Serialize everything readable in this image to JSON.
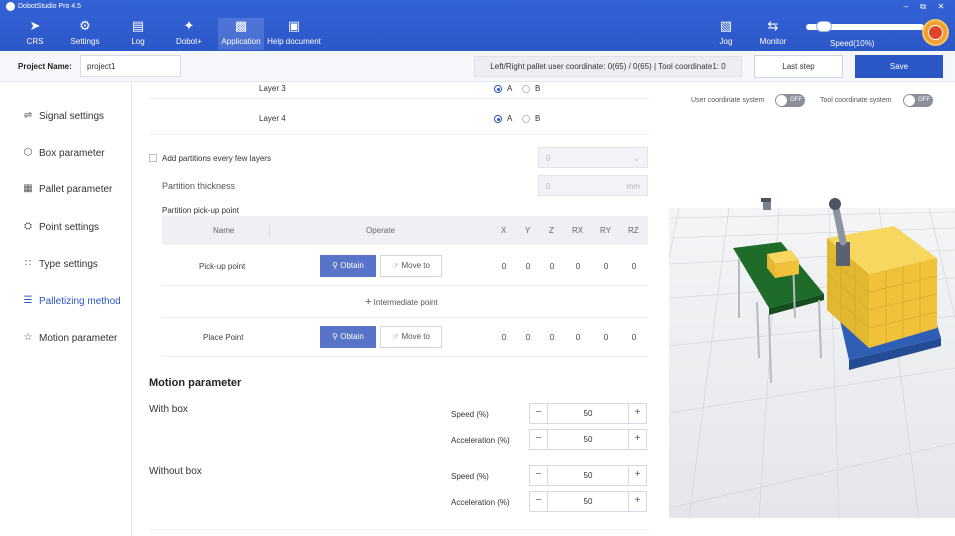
{
  "app": {
    "title": "DobotStudio Pro 4.5"
  },
  "nav": [
    {
      "label": "CRS",
      "icon": "crs-icon"
    },
    {
      "label": "Settings",
      "icon": "gear-icon"
    },
    {
      "label": "Log",
      "icon": "log-icon"
    },
    {
      "label": "Dobot+",
      "icon": "puzzle-icon"
    },
    {
      "label": "Application",
      "icon": "application-icon"
    },
    {
      "label": "Help document",
      "icon": "help-document-icon"
    }
  ],
  "right_nav": {
    "jog": "Jog",
    "monitor": "Monitor",
    "speed": "Speed(10%)",
    "speed_value": 10
  },
  "project": {
    "label": "Project Name:",
    "name": "project1",
    "coord_info": "Left/Right pallet user coordinate: 0(65) / 0(65) | Tool coordinate1: 0",
    "last_step": "Last step",
    "save": "Save"
  },
  "sidebar": [
    {
      "label": "Signal settings",
      "icon": "signal-icon"
    },
    {
      "label": "Box parameter",
      "icon": "box-icon"
    },
    {
      "label": "Pallet parameter",
      "icon": "pallet-icon"
    },
    {
      "label": "Point settings",
      "icon": "point-icon"
    },
    {
      "label": "Type settings",
      "icon": "type-icon"
    },
    {
      "label": "Palletizing method",
      "icon": "palletizing-icon"
    },
    {
      "label": "Motion parameter",
      "icon": "motion-icon"
    }
  ],
  "layers": {
    "layer3": "Layer 3",
    "layer4": "Layer 4",
    "opt_a": "A",
    "opt_b": "B"
  },
  "partitions": {
    "add_label": "Add partitions every few layers",
    "layers_value": "0",
    "thickness_label": "Partition thickness",
    "thickness_value": "0",
    "thickness_unit": "mm",
    "pickup_title": "Partition pick-up point"
  },
  "table": {
    "headers": {
      "name": "Name",
      "operate": "Operate",
      "x": "X",
      "y": "Y",
      "z": "Z",
      "rx": "RX",
      "ry": "RY",
      "rz": "RZ"
    },
    "rows": [
      {
        "name": "Pick-up point",
        "obtain": "Obtain",
        "move": "Move to",
        "x": "0",
        "y": "0",
        "z": "0",
        "rx": "0",
        "ry": "0",
        "rz": "0"
      },
      {
        "name": "Place Point",
        "obtain": "Obtain",
        "move": "Move to",
        "x": "0",
        "y": "0",
        "z": "0",
        "rx": "0",
        "ry": "0",
        "rz": "0"
      }
    ],
    "intermediate": "Intermediate point"
  },
  "motion": {
    "title": "Motion parameter",
    "with_box": "With box",
    "without_box": "Without box",
    "speed_label": "Speed  (%)",
    "accel_label": "Acceleration  (%)",
    "with_speed": "50",
    "with_accel": "50",
    "without_speed": "50",
    "without_accel": "50"
  },
  "view": {
    "user_coord": "User coordinate system",
    "tool_coord": "Tool coordinate system",
    "off": "OFF"
  },
  "colors": {
    "brand": "#2a56c6",
    "toolbar": "#3463d6",
    "conveyor": "#1f6b2a",
    "box": "#f0c23a",
    "pallet": "#2f5fb5"
  }
}
